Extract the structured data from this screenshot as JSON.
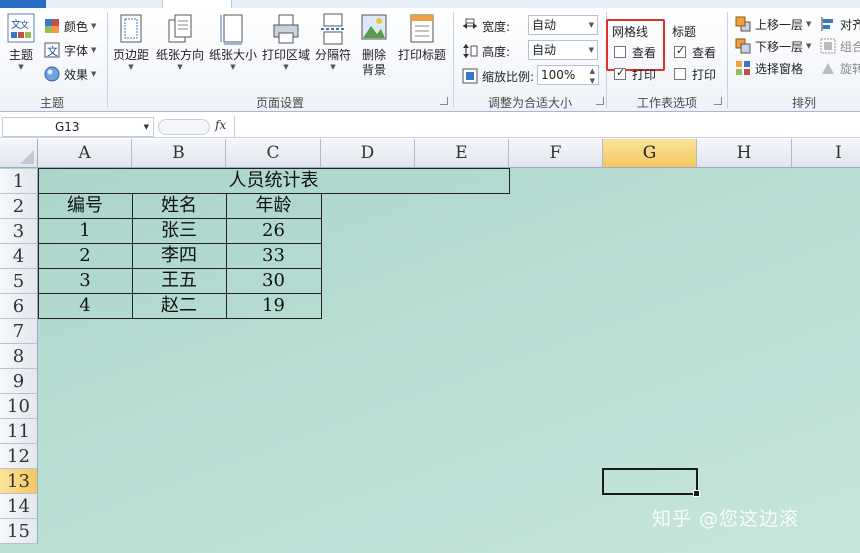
{
  "ribbon": {
    "theme_group": {
      "label": "主题",
      "theme_button": "主题",
      "colors": "颜色",
      "fonts": "字体",
      "effects": "效果"
    },
    "page_setup_group": {
      "label": "页面设置",
      "buttons": [
        "页边距",
        "纸张方向",
        "纸张大小",
        "打印区域",
        "分隔符",
        "删除背景",
        "打印标题"
      ]
    },
    "scale_group": {
      "label": "调整为合适大小",
      "width_label": "宽度:",
      "width_value": "自动",
      "height_label": "高度:",
      "height_value": "自动",
      "scale_label": "缩放比例:",
      "scale_value": "100%"
    },
    "sheet_options_group": {
      "label": "工作表选项",
      "gridlines_title": "网格线",
      "gridlines_view": "查看",
      "gridlines_view_checked": false,
      "gridlines_print": "打印",
      "gridlines_print_checked": true,
      "headings_title": "标题",
      "headings_view": "查看",
      "headings_view_checked": true,
      "headings_print": "打印",
      "headings_print_checked": false
    },
    "arrange_group": {
      "label": "排列",
      "bring_forward": "上移一层",
      "send_backward": "下移一层",
      "selection_pane": "选择窗格",
      "align": "对齐",
      "group": "组合",
      "rotate": "旋转"
    }
  },
  "formula_bar": {
    "name_box": "G13",
    "fx": "fx",
    "content": ""
  },
  "grid": {
    "columns": [
      "A",
      "B",
      "C",
      "D",
      "E",
      "F",
      "G",
      "H",
      "I"
    ],
    "rows": [
      "1",
      "2",
      "3",
      "4",
      "5",
      "6",
      "7",
      "8",
      "9",
      "10",
      "11",
      "12",
      "13",
      "14",
      "15"
    ],
    "selected_column": "G",
    "selected_row": "13",
    "table_title": "人员统计表",
    "table_headers": [
      "编号",
      "姓名",
      "年龄"
    ],
    "table_rows": [
      [
        "1",
        "张三",
        "26"
      ],
      [
        "2",
        "李四",
        "33"
      ],
      [
        "3",
        "王五",
        "30"
      ],
      [
        "4",
        "赵二",
        "19"
      ]
    ]
  },
  "watermark": "知乎 @您这边滚",
  "colors": {
    "highlight_box": "#e0302a",
    "selected_header": "#f4c760",
    "sheet_background": "#b8ddd3"
  }
}
